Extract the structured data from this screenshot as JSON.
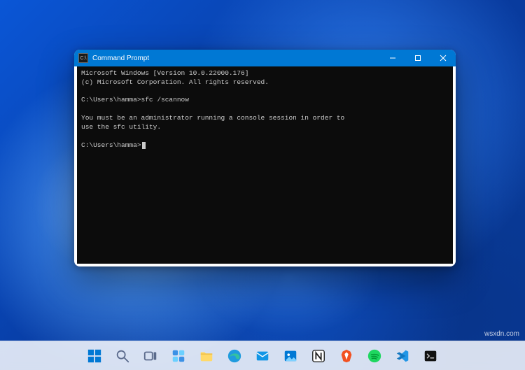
{
  "window": {
    "title": "Command Prompt",
    "icon_glyph": "C:\\"
  },
  "terminal": {
    "lines": [
      "Microsoft Windows [Version 10.0.22000.176]",
      "(c) Microsoft Corporation. All rights reserved.",
      "",
      "C:\\Users\\hamma>sfc /scannow",
      "",
      "You must be an administrator running a console session in order to",
      "use the sfc utility.",
      "",
      "C:\\Users\\hamma>"
    ]
  },
  "taskbar": {
    "items": [
      {
        "name": "start",
        "title": "Start"
      },
      {
        "name": "search",
        "title": "Search"
      },
      {
        "name": "task-view",
        "title": "Task View"
      },
      {
        "name": "widgets",
        "title": "Widgets"
      },
      {
        "name": "file-explorer",
        "title": "File Explorer"
      },
      {
        "name": "edge",
        "title": "Microsoft Edge"
      },
      {
        "name": "mail",
        "title": "Mail"
      },
      {
        "name": "photos",
        "title": "Photos"
      },
      {
        "name": "notion",
        "title": "Notion"
      },
      {
        "name": "brave",
        "title": "Brave"
      },
      {
        "name": "spotify",
        "title": "Spotify"
      },
      {
        "name": "vscode",
        "title": "Visual Studio Code"
      },
      {
        "name": "cmd",
        "title": "Command Prompt"
      }
    ]
  },
  "watermark": "wsxdn.com"
}
